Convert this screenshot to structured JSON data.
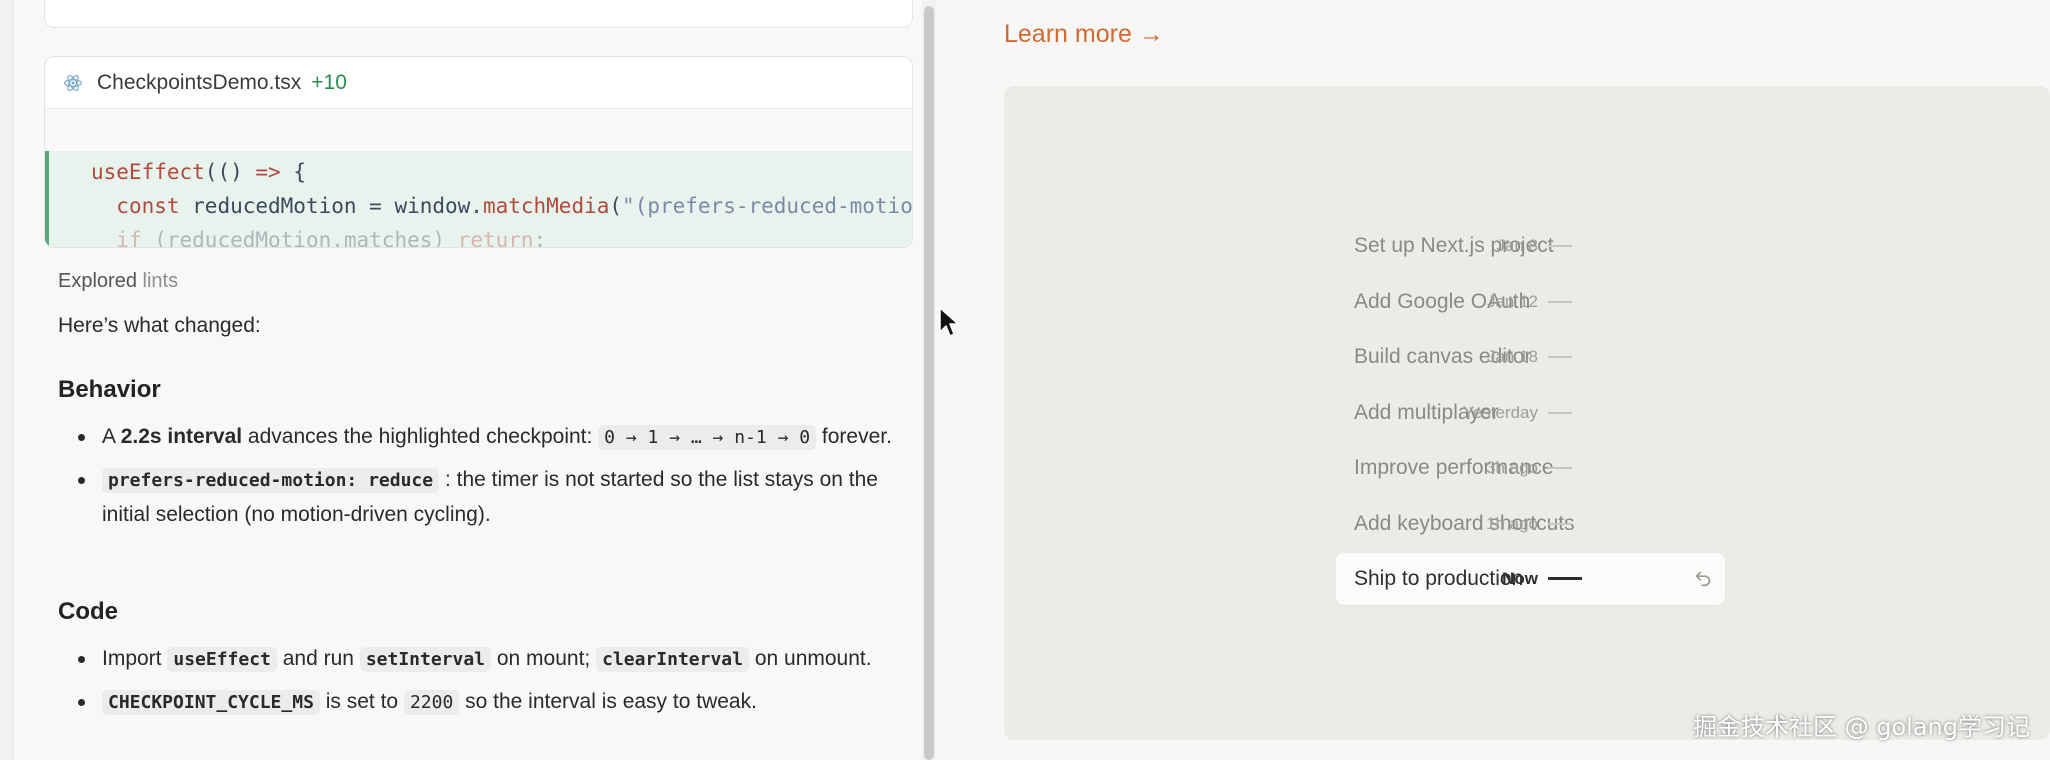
{
  "left": {
    "code_card": {
      "file_name": "CheckpointsDemo.tsx",
      "added": "+10"
    },
    "explored": {
      "prefix": "Explored",
      "suffix": "lints"
    },
    "intro": "Here’s what changed:",
    "behavior": {
      "heading": "Behavior",
      "b1_pre": "A ",
      "b1_bold": "2.2s interval",
      "b1_mid": " advances the highlighted checkpoint: ",
      "b1_code": "0 → 1 → … → n-1 → 0",
      "b1_post": " forever.",
      "b2_code": "prefers-reduced-motion: reduce",
      "b2_text": " : the timer is not started so the list stays on the initial selection (no motion-driven cycling)."
    },
    "code": {
      "heading": "Code",
      "b1_pre": "Import ",
      "b1_code1": "useEffect",
      "b1_mid": " and run ",
      "b1_code2": "setInterval",
      "b1_mid2": " on mount; ",
      "b1_code3": "clearInterval",
      "b1_post": " on unmount.",
      "b2_code1": "CHECKPOINT_CYCLE_MS",
      "b2_mid": " is set to ",
      "b2_code2": "2200",
      "b2_post": " so the interval is easy to tweak."
    }
  },
  "right": {
    "learn_more": "Learn more →",
    "timeline": [
      {
        "title": "Set up Next.js project",
        "date": "Jan 8"
      },
      {
        "title": "Add Google OAuth",
        "date": "Jan 12"
      },
      {
        "title": "Build canvas editor",
        "date": "Jan 18"
      },
      {
        "title": "Add multiplayer",
        "date": "Yesterday"
      },
      {
        "title": "Improve performance",
        "date": "3h ago"
      },
      {
        "title": "Add keyboard shortcuts",
        "date": "1h ago"
      },
      {
        "title": "Ship to production",
        "date": "Now"
      }
    ]
  },
  "watermark": "掘金技术社区 @ golang学习记",
  "icons": [
    "react-icon",
    "undo-icon",
    "arrow-cursor-icon"
  ],
  "colors": {
    "accent": "#d06a34",
    "added": "#2f8a52",
    "diff_bg": "#e9f3ee"
  }
}
